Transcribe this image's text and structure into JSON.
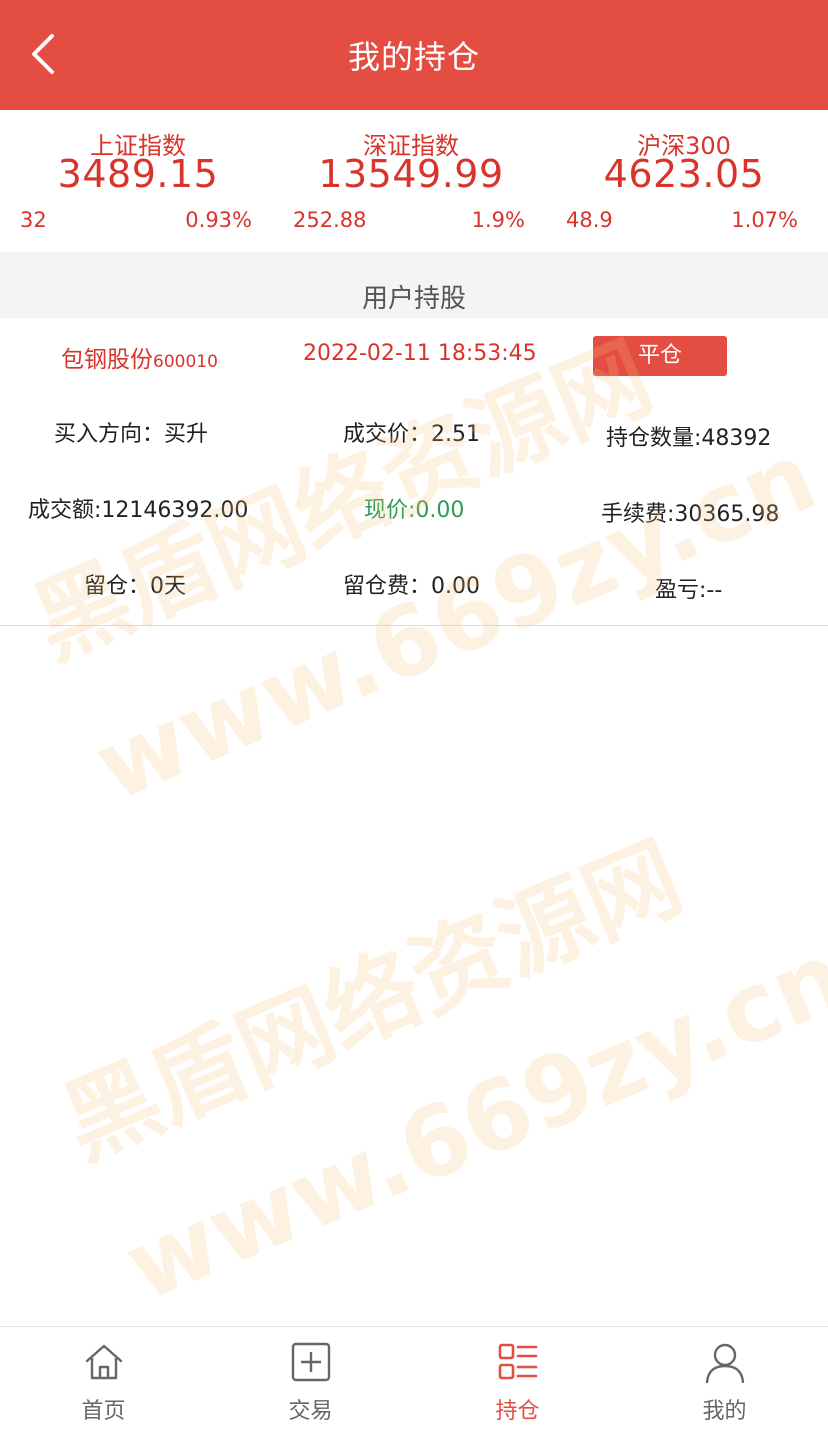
{
  "header": {
    "title": "我的持仓",
    "back_icon": "chevron-left-icon"
  },
  "indices": [
    {
      "name": "上证指数",
      "price": "3489.15",
      "change": "32",
      "pct": "0.93%"
    },
    {
      "name": "深证指数",
      "price": "13549.99",
      "change": "252.88",
      "pct": "1.9%"
    },
    {
      "name": "沪深300",
      "price": "4623.05",
      "change": "48.9",
      "pct": "1.07%"
    }
  ],
  "section": {
    "title": "用户持股"
  },
  "holding": {
    "stock_name": "包钢股份",
    "stock_code": "600010",
    "time": "2022-02-11 18:53:45",
    "close_label": "平仓",
    "direction": "买入方向：买升",
    "deal_price": "成交价：2.51",
    "quantity": "持仓数量:48392",
    "amount": "成交额:12146392.00",
    "current_price": "现价:0.00",
    "fee": "手续费:30365.98",
    "days": "留仓：0天",
    "holding_fee": "留仓费：0.00",
    "profit": "盈亏:--"
  },
  "watermark": {
    "line1": "黑盾网络资源网",
    "line2": "www.669zy.cn"
  },
  "tabbar": {
    "items": [
      {
        "label": "首页",
        "icon": "home-icon"
      },
      {
        "label": "交易",
        "icon": "plus-square-icon"
      },
      {
        "label": "持仓",
        "icon": "list-icon"
      },
      {
        "label": "我的",
        "icon": "user-icon"
      }
    ],
    "active_index": 2
  },
  "colors": {
    "brand": "#e44d42",
    "up": "#d8342b",
    "flat": "#2f9a57"
  }
}
